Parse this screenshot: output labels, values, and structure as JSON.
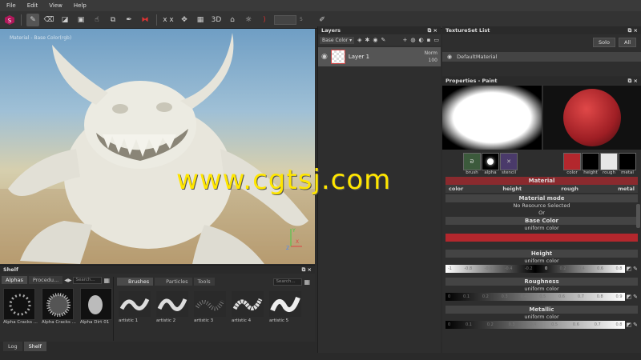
{
  "menu": [
    "File",
    "Edit",
    "View",
    "Help"
  ],
  "toolbar": {
    "stepper_value": "5"
  },
  "viewport": {
    "title": "Material - Base Color(rgb)"
  },
  "shelf": {
    "title": "Shelf",
    "left_tabs": [
      "Alphas",
      "Procedu..."
    ],
    "left_search": "Search...",
    "alphas": [
      "Alpha Cracks ...",
      "Alpha Cracks ...",
      "Alpha Dirt 01"
    ],
    "right_tabs": [
      "Brushes",
      "Particles",
      "Tools"
    ],
    "right_search": "Search...",
    "brushes": [
      "artistic 1",
      "artistic 2",
      "artistic 3",
      "artistic 4",
      "artistic 5"
    ]
  },
  "bottom_tabs": [
    "Log",
    "Shelf"
  ],
  "layers": {
    "title": "Layers",
    "channel": "Base Color",
    "layer_name": "Layer 1",
    "blend": "Norm",
    "opacity": "100"
  },
  "texture_set": {
    "title": "TextureSet List",
    "solo_label": "Solo",
    "all_label": "All",
    "item": "DefaultMaterial"
  },
  "properties": {
    "title": "Properties - Paint",
    "brush_slots": [
      "brush",
      "alpha",
      "stencil"
    ],
    "material_slots": [
      "color",
      "height",
      "rough",
      "metal"
    ],
    "material_header": "Material",
    "channels": [
      "color",
      "height",
      "rough",
      "metal"
    ],
    "material_mode_label": "Material mode",
    "no_resource": "No Resource Selected",
    "or_label": "Or",
    "base_color_label": "Base Color",
    "base_color_sub": "uniform color",
    "height_label": "Height",
    "height_sub": "uniform color",
    "height_ticks": [
      "-1",
      "-0.8",
      "-0.6",
      "-0.4",
      "-0.2",
      "0",
      "0.2",
      "0.4",
      "0.6",
      "0.8"
    ],
    "roughness_label": "Roughness",
    "roughness_sub": "uniform color",
    "roughness_ticks": [
      "0",
      "0.1",
      "0.2",
      "0.3",
      "0.4",
      "0.5",
      "0.6",
      "0.7",
      "0.8",
      "0.9"
    ],
    "metallic_label": "Metallic",
    "metallic_sub": "uniform color",
    "metallic_ticks": [
      "0",
      "0.1",
      "0.2",
      "0.3",
      "0.4",
      "0.5",
      "0.6",
      "0.7",
      "0.8"
    ]
  },
  "watermark": "www.cgtsj.com",
  "colors": {
    "accent": "#c0392b",
    "base_color": "#b3272d",
    "panel": "#2e2e2e"
  }
}
